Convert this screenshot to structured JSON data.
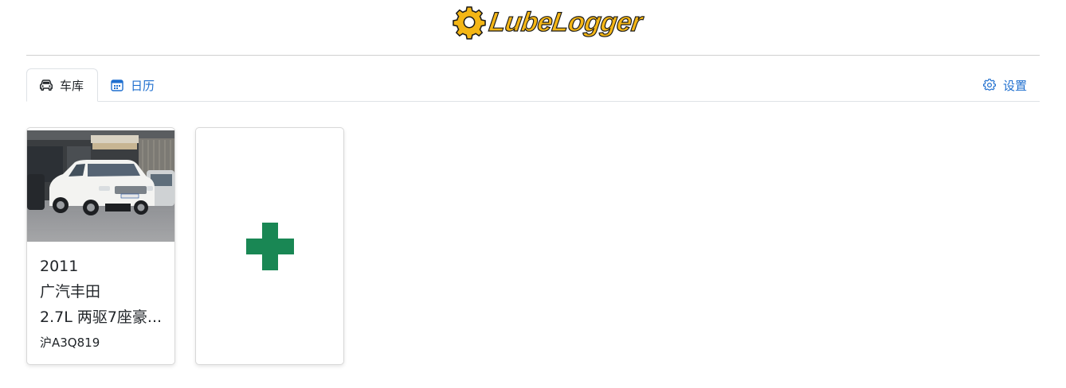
{
  "app": {
    "logo_text": "LubeLogger"
  },
  "tabs": {
    "garage_label": "车库",
    "calendar_label": "日历",
    "settings_label": "设置"
  },
  "vehicles": [
    {
      "year": "2011",
      "make": "广汽丰田",
      "model": "2.7L 两驱7座豪...",
      "plate": "沪A3Q819"
    }
  ],
  "colors": {
    "logo_yellow": "#f4b615",
    "link_blue": "#1f6fcf",
    "add_green": "#198754"
  },
  "icons": {
    "garage": "car-icon",
    "calendar": "calendar-icon",
    "settings": "gear-icon",
    "add": "plus-icon"
  }
}
